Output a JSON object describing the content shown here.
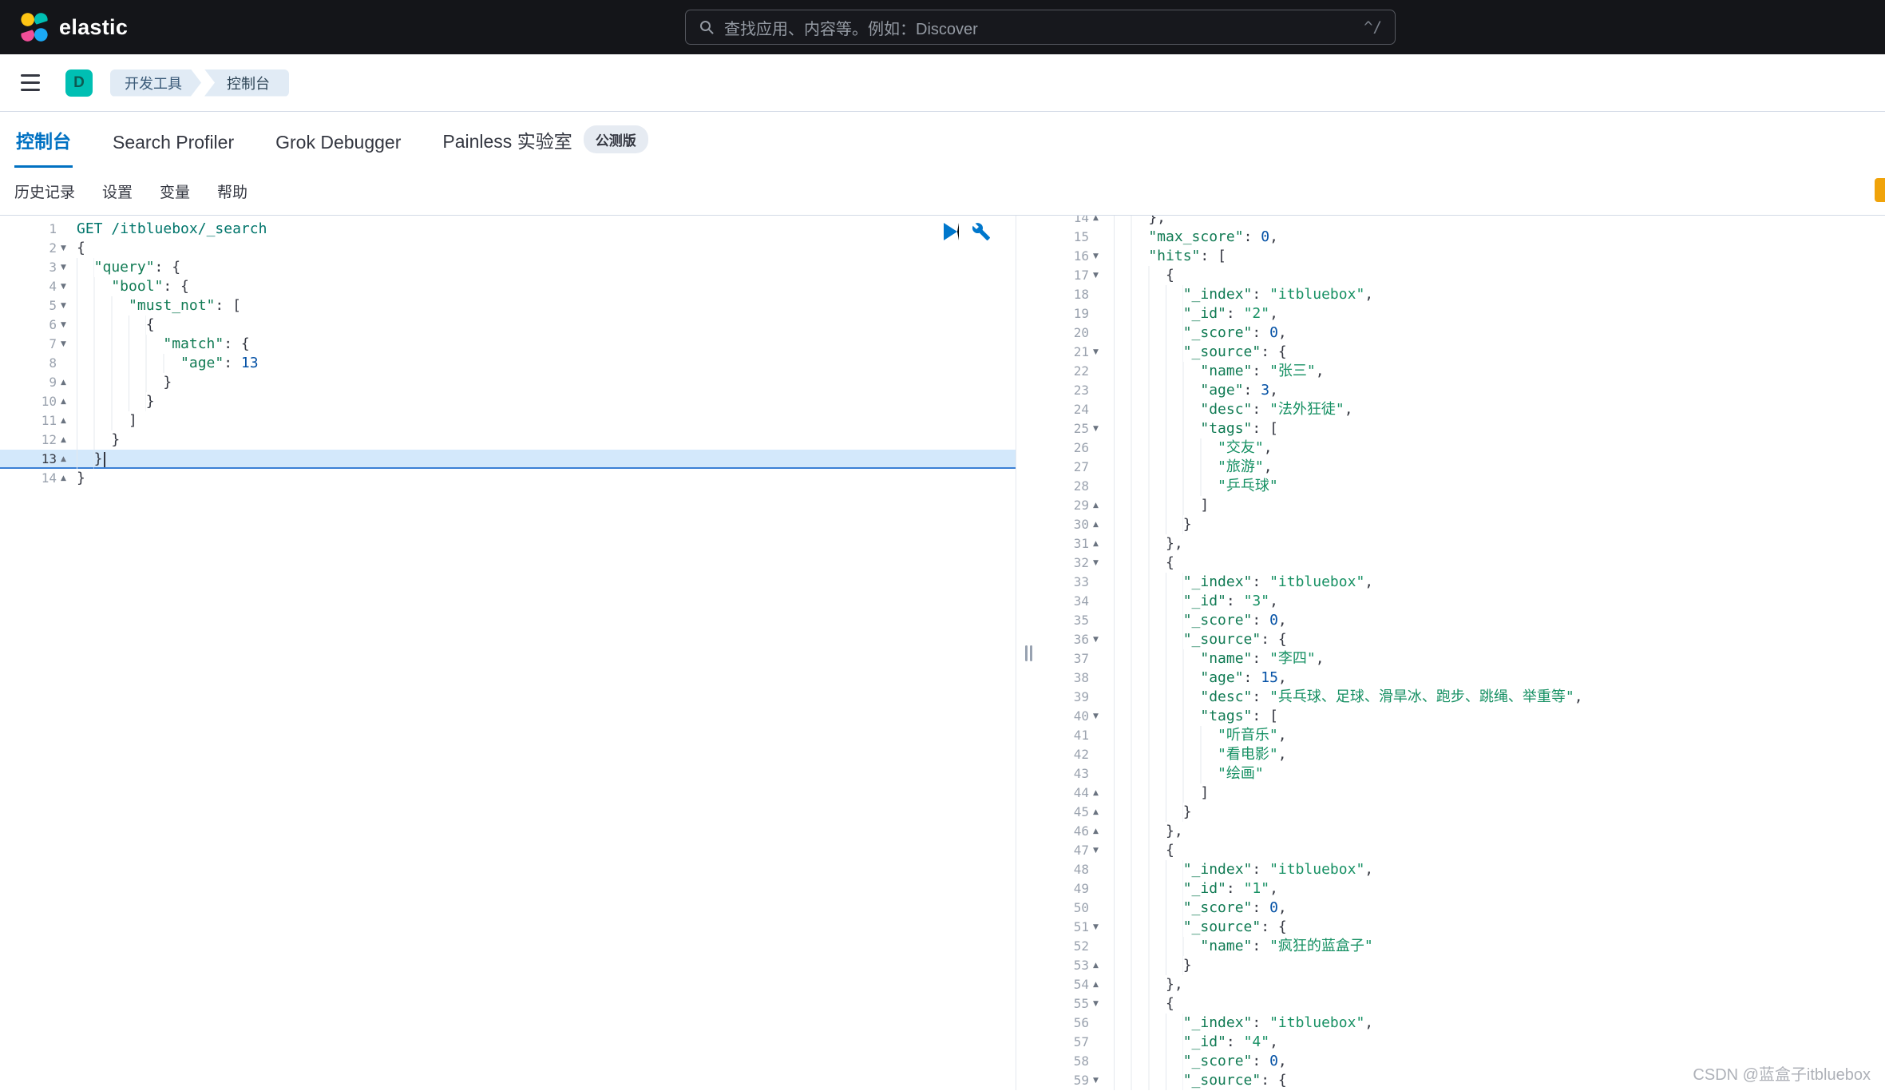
{
  "topbar": {
    "brand": "elastic",
    "search_placeholder": "查找应用、内容等。例如：Discover",
    "search_shortcut": "^/"
  },
  "breadcrumbs": {
    "space_badge": "D",
    "items": [
      "开发工具",
      "控制台"
    ]
  },
  "tabs": [
    {
      "label": "控制台",
      "active": true
    },
    {
      "label": "Search Profiler",
      "active": false
    },
    {
      "label": "Grok Debugger",
      "active": false
    },
    {
      "label": "Painless 实验室",
      "active": false,
      "badge": "公测版"
    }
  ],
  "console_menu": [
    "历史记录",
    "设置",
    "变量",
    "帮助"
  ],
  "editor": {
    "active_line": 13,
    "lines": [
      {
        "n": 1,
        "i": 0,
        "tokens": [
          [
            "method",
            "GET "
          ],
          [
            "url",
            "/itbluebox/_search"
          ]
        ]
      },
      {
        "n": 2,
        "i": 0,
        "tokens": [
          [
            "punc",
            "{"
          ]
        ]
      },
      {
        "n": 3,
        "i": 1,
        "tokens": [
          [
            "key",
            "\"query\""
          ],
          [
            "punc",
            ": {"
          ]
        ]
      },
      {
        "n": 4,
        "i": 2,
        "tokens": [
          [
            "key",
            "\"bool\""
          ],
          [
            "punc",
            ": {"
          ]
        ]
      },
      {
        "n": 5,
        "i": 3,
        "tokens": [
          [
            "key",
            "\"must_not\""
          ],
          [
            "punc",
            ": ["
          ]
        ]
      },
      {
        "n": 6,
        "i": 4,
        "tokens": [
          [
            "punc",
            "{"
          ]
        ]
      },
      {
        "n": 7,
        "i": 5,
        "tokens": [
          [
            "key",
            "\"match\""
          ],
          [
            "punc",
            ": {"
          ]
        ]
      },
      {
        "n": 8,
        "i": 6,
        "tokens": [
          [
            "key",
            "\"age\""
          ],
          [
            "punc",
            ": "
          ],
          [
            "num",
            "13"
          ]
        ]
      },
      {
        "n": 9,
        "i": 5,
        "tokens": [
          [
            "punc",
            "}"
          ]
        ]
      },
      {
        "n": 10,
        "i": 4,
        "tokens": [
          [
            "punc",
            "}"
          ]
        ]
      },
      {
        "n": 11,
        "i": 3,
        "tokens": [
          [
            "punc",
            "]"
          ]
        ]
      },
      {
        "n": 12,
        "i": 2,
        "tokens": [
          [
            "punc",
            "}"
          ]
        ]
      },
      {
        "n": 13,
        "i": 1,
        "tokens": [
          [
            "punc",
            "}"
          ],
          [
            "cursor",
            ""
          ]
        ]
      },
      {
        "n": 14,
        "i": 0,
        "tokens": [
          [
            "punc",
            "}"
          ]
        ]
      }
    ]
  },
  "response": {
    "lines": [
      {
        "n": 14,
        "i": 2,
        "tokens": [
          [
            "punc",
            "},"
          ]
        ]
      },
      {
        "n": 15,
        "i": 2,
        "tokens": [
          [
            "key",
            "\"max_score\""
          ],
          [
            "punc",
            ": "
          ],
          [
            "num",
            "0"
          ],
          [
            "punc",
            ","
          ]
        ]
      },
      {
        "n": 16,
        "i": 2,
        "tokens": [
          [
            "key",
            "\"hits\""
          ],
          [
            "punc",
            ": ["
          ]
        ]
      },
      {
        "n": 17,
        "i": 3,
        "tokens": [
          [
            "punc",
            "{"
          ]
        ]
      },
      {
        "n": 18,
        "i": 4,
        "tokens": [
          [
            "key",
            "\"_index\""
          ],
          [
            "punc",
            ": "
          ],
          [
            "str",
            "\"itbluebox\""
          ],
          [
            "punc",
            ","
          ]
        ]
      },
      {
        "n": 19,
        "i": 4,
        "tokens": [
          [
            "key",
            "\"_id\""
          ],
          [
            "punc",
            ": "
          ],
          [
            "str",
            "\"2\""
          ],
          [
            "punc",
            ","
          ]
        ]
      },
      {
        "n": 20,
        "i": 4,
        "tokens": [
          [
            "key",
            "\"_score\""
          ],
          [
            "punc",
            ": "
          ],
          [
            "num",
            "0"
          ],
          [
            "punc",
            ","
          ]
        ]
      },
      {
        "n": 21,
        "i": 4,
        "tokens": [
          [
            "key",
            "\"_source\""
          ],
          [
            "punc",
            ": {"
          ]
        ]
      },
      {
        "n": 22,
        "i": 5,
        "tokens": [
          [
            "key",
            "\"name\""
          ],
          [
            "punc",
            ": "
          ],
          [
            "str",
            "\"张三\""
          ],
          [
            "punc",
            ","
          ]
        ]
      },
      {
        "n": 23,
        "i": 5,
        "tokens": [
          [
            "key",
            "\"age\""
          ],
          [
            "punc",
            ": "
          ],
          [
            "num",
            "3"
          ],
          [
            "punc",
            ","
          ]
        ]
      },
      {
        "n": 24,
        "i": 5,
        "tokens": [
          [
            "key",
            "\"desc\""
          ],
          [
            "punc",
            ": "
          ],
          [
            "str",
            "\"法外狂徒\""
          ],
          [
            "punc",
            ","
          ]
        ]
      },
      {
        "n": 25,
        "i": 5,
        "tokens": [
          [
            "key",
            "\"tags\""
          ],
          [
            "punc",
            ": ["
          ]
        ]
      },
      {
        "n": 26,
        "i": 6,
        "tokens": [
          [
            "str",
            "\"交友\""
          ],
          [
            "punc",
            ","
          ]
        ]
      },
      {
        "n": 27,
        "i": 6,
        "tokens": [
          [
            "str",
            "\"旅游\""
          ],
          [
            "punc",
            ","
          ]
        ]
      },
      {
        "n": 28,
        "i": 6,
        "tokens": [
          [
            "str",
            "\"乒乓球\""
          ]
        ]
      },
      {
        "n": 29,
        "i": 5,
        "tokens": [
          [
            "punc",
            "]"
          ]
        ]
      },
      {
        "n": 30,
        "i": 4,
        "tokens": [
          [
            "punc",
            "}"
          ]
        ]
      },
      {
        "n": 31,
        "i": 3,
        "tokens": [
          [
            "punc",
            "},"
          ]
        ]
      },
      {
        "n": 32,
        "i": 3,
        "tokens": [
          [
            "punc",
            "{"
          ]
        ]
      },
      {
        "n": 33,
        "i": 4,
        "tokens": [
          [
            "key",
            "\"_index\""
          ],
          [
            "punc",
            ": "
          ],
          [
            "str",
            "\"itbluebox\""
          ],
          [
            "punc",
            ","
          ]
        ]
      },
      {
        "n": 34,
        "i": 4,
        "tokens": [
          [
            "key",
            "\"_id\""
          ],
          [
            "punc",
            ": "
          ],
          [
            "str",
            "\"3\""
          ],
          [
            "punc",
            ","
          ]
        ]
      },
      {
        "n": 35,
        "i": 4,
        "tokens": [
          [
            "key",
            "\"_score\""
          ],
          [
            "punc",
            ": "
          ],
          [
            "num",
            "0"
          ],
          [
            "punc",
            ","
          ]
        ]
      },
      {
        "n": 36,
        "i": 4,
        "tokens": [
          [
            "key",
            "\"_source\""
          ],
          [
            "punc",
            ": {"
          ]
        ]
      },
      {
        "n": 37,
        "i": 5,
        "tokens": [
          [
            "key",
            "\"name\""
          ],
          [
            "punc",
            ": "
          ],
          [
            "str",
            "\"李四\""
          ],
          [
            "punc",
            ","
          ]
        ]
      },
      {
        "n": 38,
        "i": 5,
        "tokens": [
          [
            "key",
            "\"age\""
          ],
          [
            "punc",
            ": "
          ],
          [
            "num",
            "15"
          ],
          [
            "punc",
            ","
          ]
        ]
      },
      {
        "n": 39,
        "i": 5,
        "tokens": [
          [
            "key",
            "\"desc\""
          ],
          [
            "punc",
            ": "
          ],
          [
            "str",
            "\"兵乓球、足球、滑旱冰、跑步、跳绳、举重等\""
          ],
          [
            "punc",
            ","
          ]
        ]
      },
      {
        "n": 40,
        "i": 5,
        "tokens": [
          [
            "key",
            "\"tags\""
          ],
          [
            "punc",
            ": ["
          ]
        ]
      },
      {
        "n": 41,
        "i": 6,
        "tokens": [
          [
            "str",
            "\"听音乐\""
          ],
          [
            "punc",
            ","
          ]
        ]
      },
      {
        "n": 42,
        "i": 6,
        "tokens": [
          [
            "str",
            "\"看电影\""
          ],
          [
            "punc",
            ","
          ]
        ]
      },
      {
        "n": 43,
        "i": 6,
        "tokens": [
          [
            "str",
            "\"绘画\""
          ]
        ]
      },
      {
        "n": 44,
        "i": 5,
        "tokens": [
          [
            "punc",
            "]"
          ]
        ]
      },
      {
        "n": 45,
        "i": 4,
        "tokens": [
          [
            "punc",
            "}"
          ]
        ]
      },
      {
        "n": 46,
        "i": 3,
        "tokens": [
          [
            "punc",
            "},"
          ]
        ]
      },
      {
        "n": 47,
        "i": 3,
        "tokens": [
          [
            "punc",
            "{"
          ]
        ]
      },
      {
        "n": 48,
        "i": 4,
        "tokens": [
          [
            "key",
            "\"_index\""
          ],
          [
            "punc",
            ": "
          ],
          [
            "str",
            "\"itbluebox\""
          ],
          [
            "punc",
            ","
          ]
        ]
      },
      {
        "n": 49,
        "i": 4,
        "tokens": [
          [
            "key",
            "\"_id\""
          ],
          [
            "punc",
            ": "
          ],
          [
            "str",
            "\"1\""
          ],
          [
            "punc",
            ","
          ]
        ]
      },
      {
        "n": 50,
        "i": 4,
        "tokens": [
          [
            "key",
            "\"_score\""
          ],
          [
            "punc",
            ": "
          ],
          [
            "num",
            "0"
          ],
          [
            "punc",
            ","
          ]
        ]
      },
      {
        "n": 51,
        "i": 4,
        "tokens": [
          [
            "key",
            "\"_source\""
          ],
          [
            "punc",
            ": {"
          ]
        ]
      },
      {
        "n": 52,
        "i": 5,
        "tokens": [
          [
            "key",
            "\"name\""
          ],
          [
            "punc",
            ": "
          ],
          [
            "str",
            "\"疯狂的蓝盒子\""
          ]
        ]
      },
      {
        "n": 53,
        "i": 4,
        "tokens": [
          [
            "punc",
            "}"
          ]
        ]
      },
      {
        "n": 54,
        "i": 3,
        "tokens": [
          [
            "punc",
            "},"
          ]
        ]
      },
      {
        "n": 55,
        "i": 3,
        "tokens": [
          [
            "punc",
            "{"
          ]
        ]
      },
      {
        "n": 56,
        "i": 4,
        "tokens": [
          [
            "key",
            "\"_index\""
          ],
          [
            "punc",
            ": "
          ],
          [
            "str",
            "\"itbluebox\""
          ],
          [
            "punc",
            ","
          ]
        ]
      },
      {
        "n": 57,
        "i": 4,
        "tokens": [
          [
            "key",
            "\"_id\""
          ],
          [
            "punc",
            ": "
          ],
          [
            "str",
            "\"4\""
          ],
          [
            "punc",
            ","
          ]
        ]
      },
      {
        "n": 58,
        "i": 4,
        "tokens": [
          [
            "key",
            "\"_score\""
          ],
          [
            "punc",
            ": "
          ],
          [
            "num",
            "0"
          ],
          [
            "punc",
            ","
          ]
        ]
      },
      {
        "n": 59,
        "i": 4,
        "tokens": [
          [
            "key",
            "\"_source\""
          ],
          [
            "punc",
            ": {"
          ]
        ]
      }
    ]
  },
  "watermark": "CSDN @蓝盒子itbluebox",
  "colors": {
    "accent": "#0071c2",
    "header_bg": "#141519",
    "avatar": "#00bfb3",
    "active_line_bg": "#d3e8fb",
    "key_green": "#117b54",
    "number_blue": "#0451a5",
    "edge_marker": "#f0a30a"
  }
}
